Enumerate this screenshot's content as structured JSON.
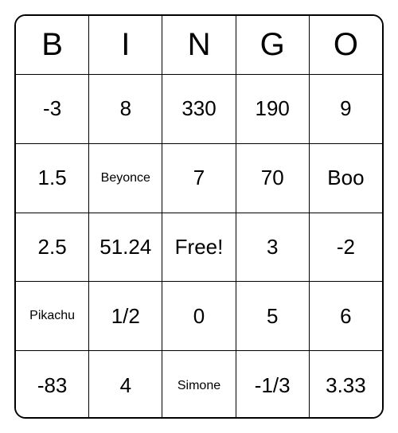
{
  "headers": [
    "B",
    "I",
    "N",
    "G",
    "O"
  ],
  "grid": [
    [
      {
        "v": "-3",
        "small": false
      },
      {
        "v": "8",
        "small": false
      },
      {
        "v": "330",
        "small": false
      },
      {
        "v": "190",
        "small": false
      },
      {
        "v": "9",
        "small": false
      }
    ],
    [
      {
        "v": "1.5",
        "small": false
      },
      {
        "v": "Beyonce",
        "small": true
      },
      {
        "v": "7",
        "small": false
      },
      {
        "v": "70",
        "small": false
      },
      {
        "v": "Boo",
        "small": false
      }
    ],
    [
      {
        "v": "2.5",
        "small": false
      },
      {
        "v": "51.24",
        "small": false
      },
      {
        "v": "Free!",
        "small": false
      },
      {
        "v": "3",
        "small": false
      },
      {
        "v": "-2",
        "small": false
      }
    ],
    [
      {
        "v": "Pikachu",
        "small": true
      },
      {
        "v": "1/2",
        "small": false
      },
      {
        "v": "0",
        "small": false
      },
      {
        "v": "5",
        "small": false
      },
      {
        "v": "6",
        "small": false
      }
    ],
    [
      {
        "v": "-83",
        "small": false
      },
      {
        "v": "4",
        "small": false
      },
      {
        "v": "Simone",
        "small": true
      },
      {
        "v": "-1/3",
        "small": false
      },
      {
        "v": "3.33",
        "small": false
      }
    ]
  ]
}
